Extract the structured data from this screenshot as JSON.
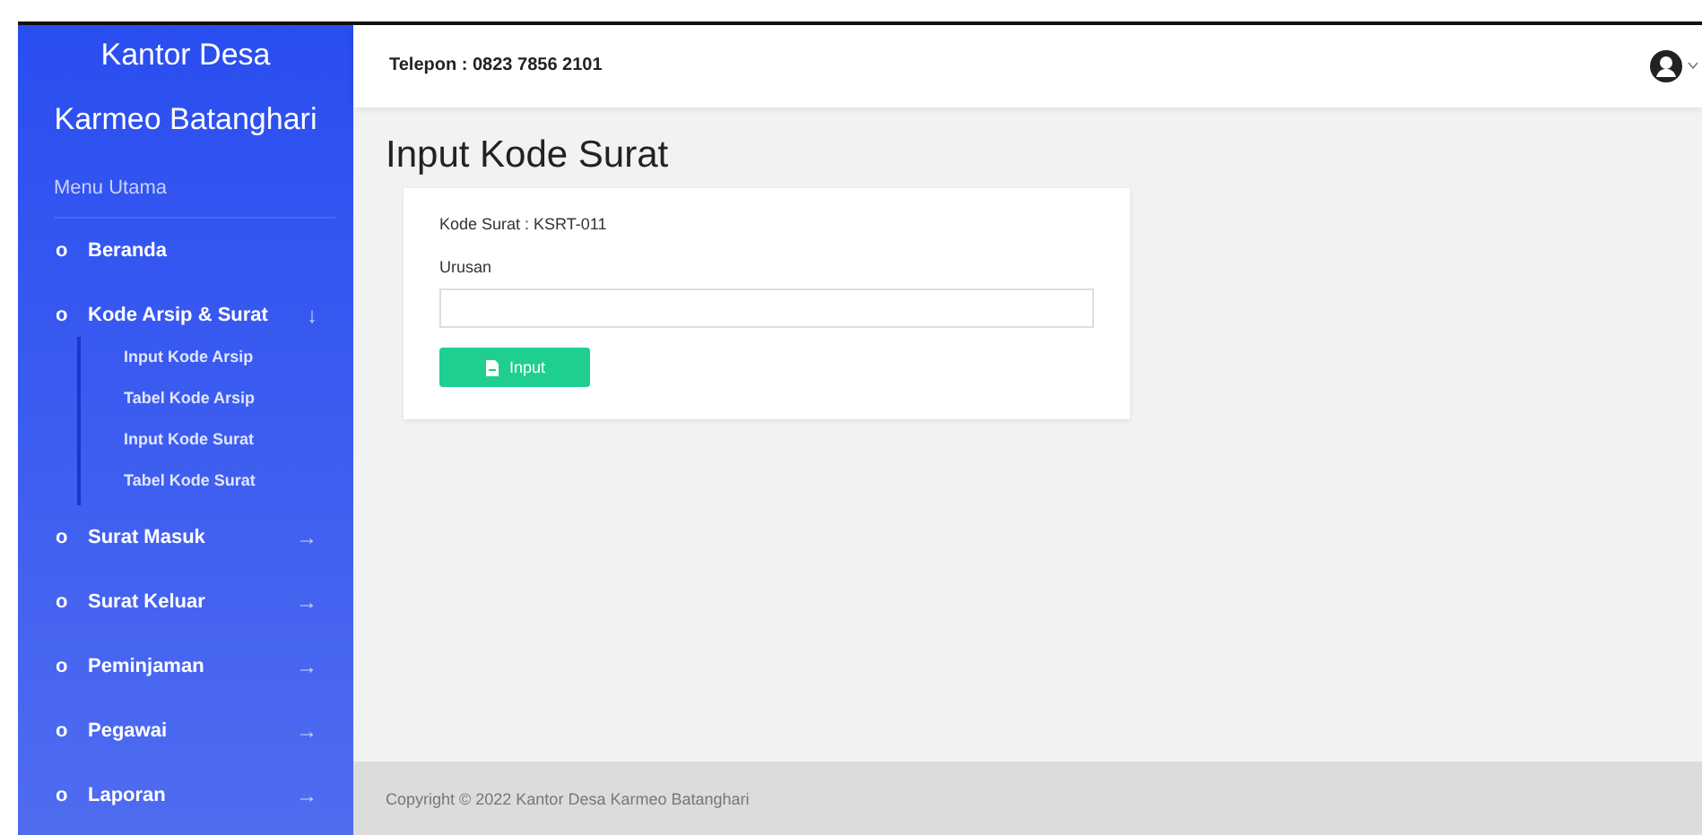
{
  "sidebar": {
    "brand": [
      "Kantor Desa",
      "Karmeo Batanghari"
    ],
    "section": "Menu Utama",
    "items": [
      {
        "label": "Beranda",
        "bullet": "o"
      },
      {
        "label": "Kode Arsip & Surat",
        "bullet": "o",
        "arrow": "↓",
        "children": [
          {
            "label": "Input Kode Arsip"
          },
          {
            "label": "Tabel Kode Arsip"
          },
          {
            "label": "Input Kode Surat"
          },
          {
            "label": "Tabel Kode Surat"
          }
        ]
      },
      {
        "label": "Surat Masuk",
        "bullet": "o",
        "arrow": "→"
      },
      {
        "label": "Surat Keluar",
        "bullet": "o",
        "arrow": "→"
      },
      {
        "label": "Peminjaman",
        "bullet": "o",
        "arrow": "→"
      },
      {
        "label": "Pegawai",
        "bullet": "o",
        "arrow": "→"
      },
      {
        "label": "Laporan",
        "bullet": "o",
        "arrow": "→"
      }
    ]
  },
  "topbar": {
    "phone": "Telepon : 0823 7856 2101"
  },
  "page": {
    "title": "Input Kode Surat",
    "code_line": "Kode Surat : KSRT-011",
    "field_label": "Urusan",
    "button": "Input"
  },
  "footer": "Copyright © 2022 Kantor Desa Karmeo Batanghari"
}
